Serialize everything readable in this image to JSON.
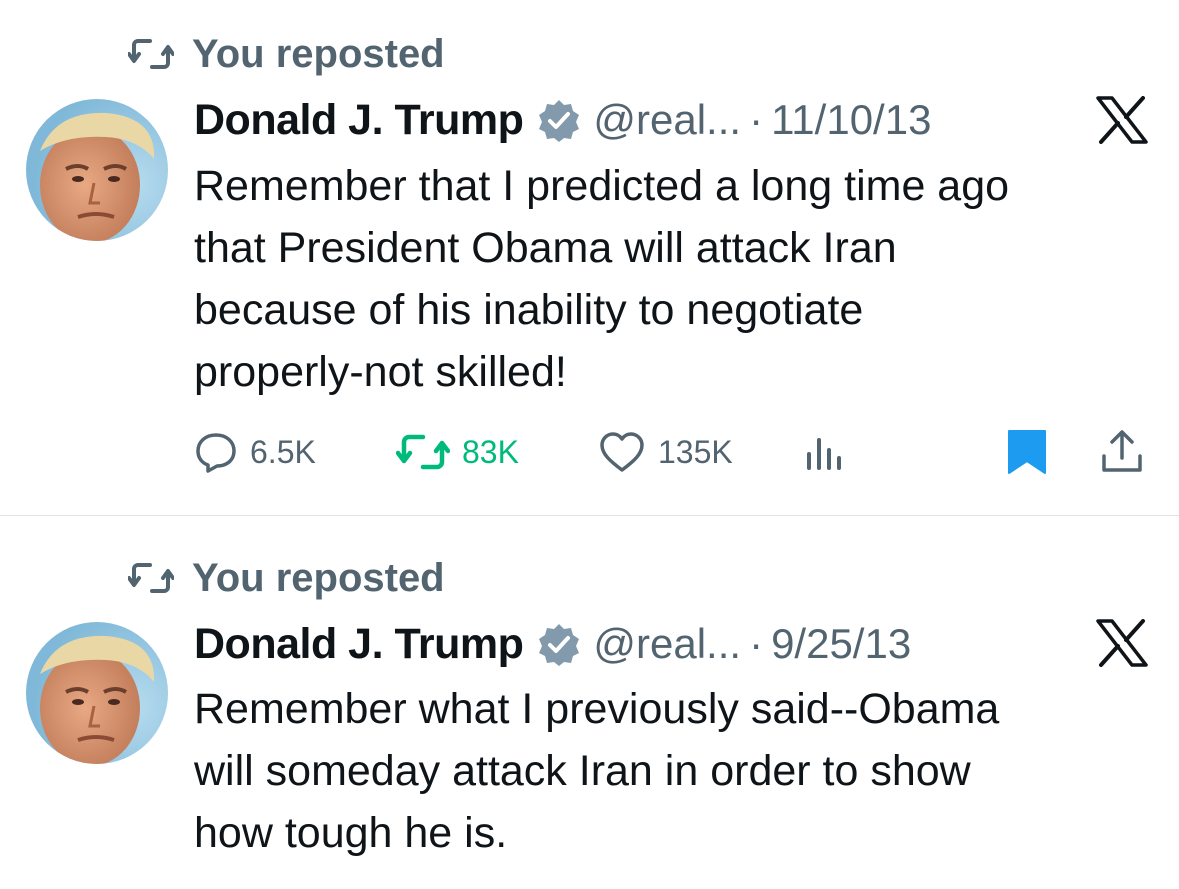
{
  "posts": [
    {
      "repost_label": "You reposted",
      "author_name": "Donald J. Trump",
      "handle": "@real...",
      "separator": "·",
      "date": "11/10/13",
      "text_lines": [
        "Remember that I predicted a long time ago",
        "that President Obama will attack Iran",
        "because of his inability to negotiate",
        "properly-not skilled!"
      ],
      "replies": "6.5K",
      "reposts": "83K",
      "likes": "135K",
      "reposted_by_me": true,
      "bookmarked": true
    },
    {
      "repost_label": "You reposted",
      "author_name": "Donald J. Trump",
      "handle": "@real...",
      "separator": "·",
      "date": "9/25/13",
      "text_lines": [
        "Remember what I previously said--Obama",
        "will someday attack Iran in order to show",
        "how tough he is."
      ]
    }
  ],
  "icons": {
    "repost": "repost-icon",
    "verified": "verified-badge-icon",
    "platform": "x-logo-icon",
    "reply": "reply-icon",
    "like": "heart-icon",
    "views": "views-icon",
    "bookmark": "bookmark-icon",
    "share": "share-icon"
  },
  "colors": {
    "text": "#0f1419",
    "secondary": "#536471",
    "repost_active": "#00ba7c",
    "bookmark_active": "#1d9bf0",
    "divider": "#e1e5e8"
  }
}
